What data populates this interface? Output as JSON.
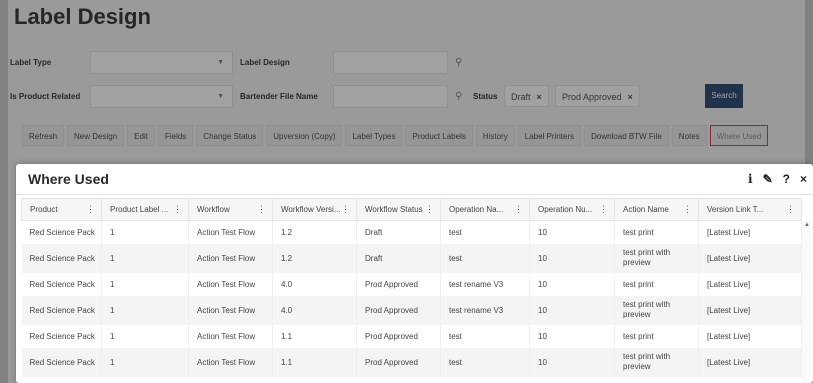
{
  "page": {
    "title": "Label Design",
    "filters": {
      "label_type": "Label Type",
      "label_design": "Label Design",
      "is_product_related": "Is Product Related",
      "bartender_file_name": "Bartender File Name",
      "status": "Status",
      "status_chips": [
        "Draft",
        "Prod Approved"
      ],
      "search_button": "Search"
    },
    "toolbar": [
      "Refresh",
      "New Design",
      "Edit",
      "Fields",
      "Change Status",
      "Upversion (Copy)",
      "Label Types",
      "Product Labels",
      "History",
      "Label Printers",
      "Download BTW File",
      "Notes",
      "Where Used"
    ]
  },
  "modal": {
    "title": "Where Used",
    "header_icons": [
      "info-icon",
      "edit-icon",
      "help-icon",
      "close-icon"
    ],
    "header_glyphs": [
      "i",
      "✎",
      "?",
      "×"
    ],
    "columns": [
      "Product",
      "Product Label ...",
      "Workflow",
      "Workflow Versi...",
      "Workflow Status",
      "Operation Na...",
      "Operation Nu...",
      "Action Name",
      "Version Link T..."
    ],
    "rows": [
      [
        "Red Science Pack",
        "1",
        "Action Test Flow",
        "1.2",
        "Draft",
        "test",
        "10",
        "test print",
        "[Latest Live]"
      ],
      [
        "Red Science Pack",
        "1",
        "Action Test Flow",
        "1.2",
        "Draft",
        "test",
        "10",
        "test print with preview",
        "[Latest Live]"
      ],
      [
        "Red Science Pack",
        "1",
        "Action Test Flow",
        "4.0",
        "Prod Approved",
        "test rename V3",
        "10",
        "test print",
        "[Latest Live]"
      ],
      [
        "Red Science Pack",
        "1",
        "Action Test Flow",
        "4.0",
        "Prod Approved",
        "test rename V3",
        "10",
        "test print with preview",
        "[Latest Live]"
      ],
      [
        "Red Science Pack",
        "1",
        "Action Test Flow",
        "1.1",
        "Prod Approved",
        "test",
        "10",
        "test print",
        "[Latest Live]"
      ],
      [
        "Red Science Pack",
        "1",
        "Action Test Flow",
        "1.1",
        "Prod Approved",
        "test",
        "10",
        "test print with preview",
        "[Latest Live]"
      ]
    ]
  },
  "colors": {
    "search_button": "#23416b",
    "active_toolbar_border": "#d23a3a"
  }
}
